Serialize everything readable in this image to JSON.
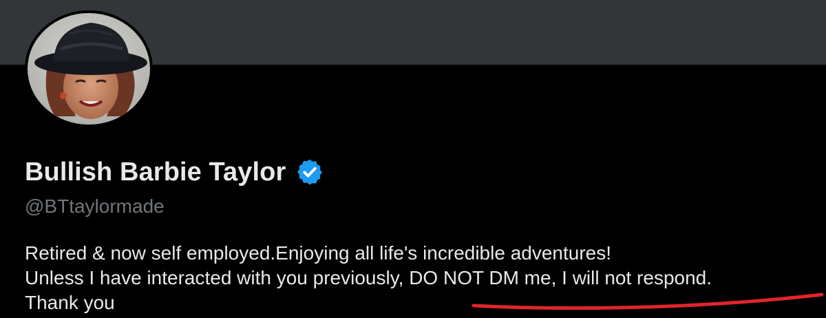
{
  "profile": {
    "display_name": "Bullish Barbie Taylor",
    "handle": "@BTtaylormade",
    "verified_icon": "verified-badge-icon",
    "bio_lines": [
      "Retired & now self employed.Enjoying all life's incredible adventures!",
      "Unless I have interacted with you previously, DO NOT DM me, I will not respond.",
      "Thank you"
    ]
  },
  "colors": {
    "background": "#000000",
    "banner": "#333639",
    "text_primary": "#e7e9ea",
    "text_secondary": "#71767b",
    "verified_blue": "#1d9bf0",
    "annotation_red": "#e0252a"
  },
  "annotation": {
    "type": "red-underline",
    "target_text": "DO NOT DM me, I will not respond."
  }
}
